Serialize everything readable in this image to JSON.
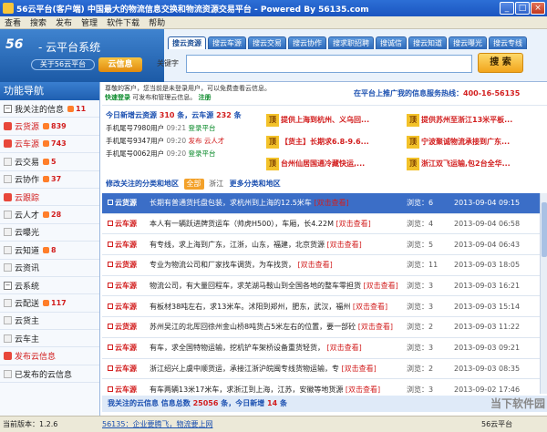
{
  "window": {
    "title": "56云平台(客户端) 中国最大的物流信息交换和物流资源交易平台 - Powered By 56135.com"
  },
  "menu": [
    "查看",
    "搜索",
    "发布",
    "管理",
    "软件下载",
    "帮助"
  ],
  "brand": {
    "logo": "56",
    "name": "- 云平台系统",
    "sub": "关于56云平台",
    "badge": "云信息"
  },
  "tabs": [
    "搜云资源",
    "搜云车源",
    "搜云交易",
    "搜云协作",
    "搜求职招聘",
    "搜诚信",
    "搜云知道",
    "搜云曝光",
    "搜云专线"
  ],
  "search": {
    "label": "关键字",
    "placeholder": "",
    "button": "搜 索"
  },
  "sidebar": {
    "title": "功能导航",
    "items": [
      {
        "label": "我关注的信息",
        "count": "11",
        "style": "group"
      },
      {
        "label": "云货源",
        "count": "839",
        "style": "red"
      },
      {
        "label": "云车源",
        "count": "743",
        "style": "red"
      },
      {
        "label": "云交易",
        "count": "5",
        "style": "doc"
      },
      {
        "label": "云协作",
        "count": "37",
        "style": "doc"
      },
      {
        "label": "云跟踪",
        "count": "",
        "style": "red"
      },
      {
        "label": "云人才",
        "count": "28",
        "style": "doc"
      },
      {
        "label": "云曝光",
        "count": "",
        "style": "doc"
      },
      {
        "label": "云知道",
        "count": "8",
        "style": "doc"
      },
      {
        "label": "云资讯",
        "count": "",
        "style": "doc"
      },
      {
        "label": "云系统",
        "count": "",
        "style": "group"
      },
      {
        "label": "云配送",
        "count": "117",
        "style": "doc"
      },
      {
        "label": "云货主",
        "count": "",
        "style": "doc"
      },
      {
        "label": "云车主",
        "count": "",
        "style": "doc"
      },
      {
        "label": "发布云信息",
        "count": "",
        "style": "red"
      },
      {
        "label": "已发布的云信息",
        "count": "",
        "style": "doc"
      }
    ]
  },
  "notice": {
    "line1": "尊敬的客户，您当前是未登录用户，可以免费查看云信息。",
    "login": "快速登录",
    "line2": "可发布和管理云信息。",
    "register": "注册",
    "right_prefix": "在平台上推广我的信息服务热线：",
    "hotline": "400-16-56135"
  },
  "updates": {
    "head_prefix": "今日新增云资源",
    "goods_count": "310",
    "unit": "条，云车源",
    "vehicle_count": "232",
    "unit2": "条",
    "rows": [
      {
        "who": "手机尾号7980用户",
        "time": "09:21",
        "act": "登录平台",
        "red": false
      },
      {
        "who": "手机尾号9347用户",
        "time": "09:20",
        "act": "发布  云人才",
        "red": true
      },
      {
        "who": "手机尾号0062用户",
        "time": "09:20",
        "act": "登录平台",
        "red": false
      }
    ]
  },
  "ads": [
    {
      "badge": "顶",
      "text": "提供上海到杭州、义乌回..."
    },
    {
      "badge": "顶",
      "text": "提供苏州至浙江13米平板..."
    },
    {
      "badge": "顶",
      "text": "【货主】长期求6.8-9.6..."
    },
    {
      "badge": "顶",
      "text": "宁波聚诚物流承接到广东..."
    },
    {
      "badge": "顶",
      "text": "台州仙居国通冷藏快运,..."
    },
    {
      "badge": "顶",
      "text": "浙江双飞运输,包2台全华..."
    }
  ],
  "filter": {
    "edit_link": "修改关注的分类和地区",
    "pills": [
      "全部"
    ],
    "region": "浙江",
    "more": "更多分类和地区"
  },
  "list": {
    "rows": [
      {
        "cat": "云货源",
        "text": "长期有普通货托盘包装，求杭州到上海的12.5米车",
        "tag": "[双击查看]",
        "views": "浏览：6",
        "date": "2013-09-04 09:15",
        "sel": true
      },
      {
        "cat": "云车源",
        "text": "本人有一辆跃进牌货运车（帅虎H500），车厢，长4.22M",
        "tag": "[双击查看]",
        "views": "浏览：4",
        "date": "2013-09-04 06:58",
        "sel": false
      },
      {
        "cat": "云车源",
        "text": "有专线，求上海到广东，江浙，山东，福建，北京货源",
        "tag": "[双击查看]",
        "views": "浏览：5",
        "date": "2013-09-04 06:43",
        "sel": false
      },
      {
        "cat": "云货源",
        "text": "专业为物流公司和厂家找车调货，为车找货，",
        "tag": "[双击查看]",
        "views": "浏览：11",
        "date": "2013-09-03 18:05",
        "sel": false
      },
      {
        "cat": "云车源",
        "text": "物流公司，有大量回程车，求芜湖马鞍山到全国各地的整车零担货",
        "tag": "[双击查看]",
        "views": "浏览：3",
        "date": "2013-09-03 16:21",
        "sel": false
      },
      {
        "cat": "云车源",
        "text": "有板材38吨左右，求13米车。沭阳到郑州，肥东，武汉，福州",
        "tag": "[双击查看]",
        "views": "浏览：3",
        "date": "2013-09-03 15:14",
        "sel": false
      },
      {
        "cat": "云货源",
        "text": "苏州吴江的北厍回徐州金山桥8吨货占5米左右的位置，要一部砼",
        "tag": "[双击查看]",
        "views": "浏览：2",
        "date": "2013-09-03 11:22",
        "sel": false
      },
      {
        "cat": "云车源",
        "text": "有车，求全国特物运输，挖机铲车架桥设备重货轻货，",
        "tag": "[双击查看]",
        "views": "浏览：3",
        "date": "2013-09-03 09:21",
        "sel": false
      },
      {
        "cat": "云车源",
        "text": "浙江绍兴上虞中顺货运，承接江浙沪皖闽专线货物运输，专",
        "tag": "[双击查看]",
        "views": "浏览：2",
        "date": "2013-09-03 08:35",
        "sel": false
      },
      {
        "cat": "云车源",
        "text": "有车两辆13米17米车，求浙江到上海，江苏，安徽等地货源",
        "tag": "[双击查看]",
        "views": "浏览：3",
        "date": "2013-09-02 17:46",
        "sel": false
      }
    ]
  },
  "footer": {
    "prefix": "我关注的云信息 信息总数",
    "total": "25056",
    "mid": "条，今日新增",
    "today": "14",
    "suffix": "条"
  },
  "status": {
    "version": "当前版本：1.2.6",
    "marquee": "56135：企业要腾飞，物流要上网",
    "platform": "56云平台"
  },
  "watermark": "当下软件园",
  "colors": {
    "accent": "#1f5fb0",
    "highlight_row": "#3b6ec7",
    "alert": "#d21e1e"
  }
}
